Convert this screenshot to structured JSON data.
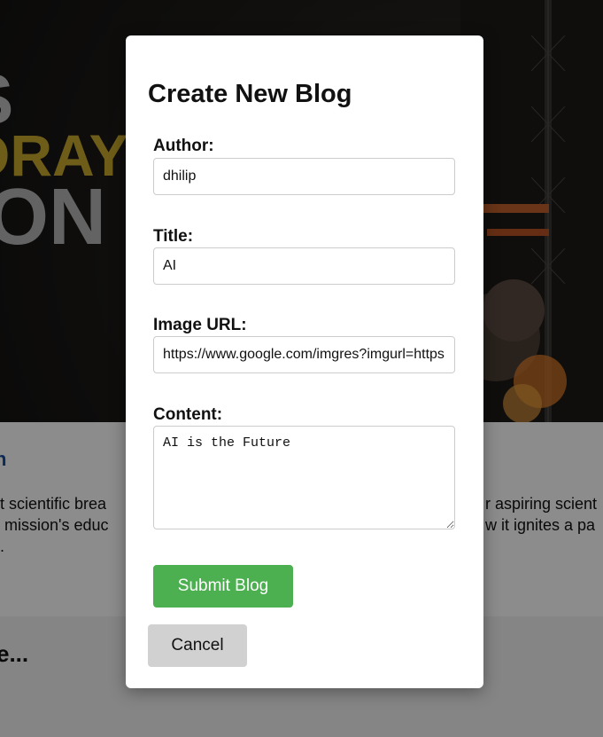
{
  "background": {
    "hero_words": [
      "S",
      "ORAY",
      "ION"
    ],
    "article_title": "n",
    "article_text_left": [
      "ut scientific brea",
      "e mission's educ",
      "n."
    ],
    "article_text_right": [
      "r aspiring scient",
      "w it ignites a pa"
    ],
    "more_heading": "e..."
  },
  "modal": {
    "title": "Create New Blog",
    "author_label": "Author:",
    "author_value": "dhilip",
    "title_label": "Title:",
    "title_value": "AI",
    "image_label": "Image URL:",
    "image_value": "https://www.google.com/imgres?imgurl=https",
    "content_label": "Content:",
    "content_value": "AI is the Future",
    "submit_label": "Submit Blog",
    "cancel_label": "Cancel"
  },
  "colors": {
    "submit_bg": "#4caf50",
    "cancel_bg": "#d1d1d1",
    "overlay": "rgba(0,0,0,0.45)"
  }
}
